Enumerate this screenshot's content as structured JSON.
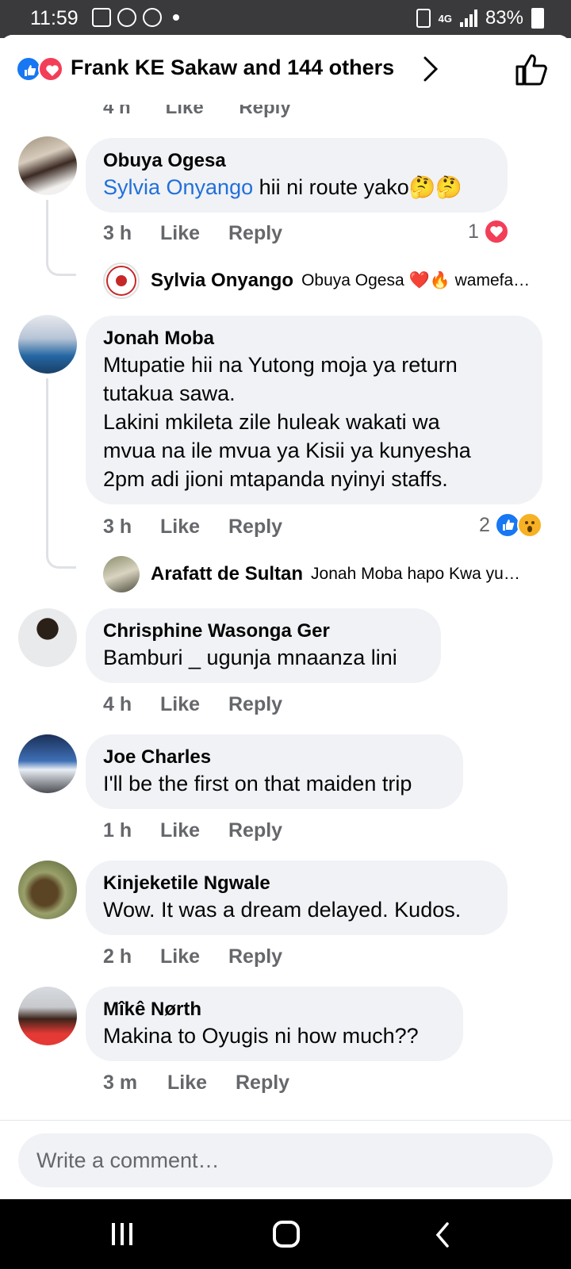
{
  "status_bar": {
    "time": "11:59",
    "network": "4G",
    "battery": "83%"
  },
  "reactions_header": {
    "title": "Frank KE Sakaw and 144 others"
  },
  "partial_comment": {
    "time": "4 h",
    "like": "Like",
    "reply": "Reply"
  },
  "comments": [
    {
      "author": "Obuya Ogesa",
      "mention": "Sylvia Onyango",
      "text": " hii ni route yako🤔🤔",
      "time": "3 h",
      "like": "Like",
      "reply": "Reply",
      "reaction_count": "1",
      "reply_preview": {
        "author": "Sylvia Onyango",
        "text": "Obuya Ogesa ❤️🔥 wamefa…"
      }
    },
    {
      "author": "Jonah Moba",
      "lines": [
        "Mtupatie hii na Yutong moja ya return",
        "tutakua sawa.",
        "Lakini mkileta zile huleak wakati wa",
        "mvua na ile mvua ya Kisii ya kunyesha",
        "2pm adi jioni mtapanda nyinyi staffs."
      ],
      "time": "3 h",
      "like": "Like",
      "reply": "Reply",
      "reaction_count": "2",
      "reply_preview": {
        "author": "Arafatt de Sultan",
        "text": "Jonah Moba hapo Kwa yu…"
      }
    },
    {
      "author": "Chrisphine Wasonga Ger",
      "text": "Bamburi _ ugunja mnaanza lini",
      "time": "4 h",
      "like": "Like",
      "reply": "Reply"
    },
    {
      "author": "Joe Charles",
      "text": "I'll be the first on that maiden trip",
      "time": "1 h",
      "like": "Like",
      "reply": "Reply"
    },
    {
      "author": "Kinjeketile Ngwale",
      "text": "Wow. It was a dream delayed. Kudos.",
      "time": "2 h",
      "like": "Like",
      "reply": "Reply"
    },
    {
      "author": "Mîkê Nørth",
      "text": "Makina to Oyugis ni how much??",
      "time": "3 m",
      "like": "Like",
      "reply": "Reply"
    }
  ],
  "composer": {
    "placeholder": "Write a comment…"
  },
  "colors": {
    "accent": "#1877f2",
    "love": "#f33e58",
    "wow": "#f7b125",
    "mention": "#216fdb",
    "bubble": "#f0f2f5",
    "meta": "#65676b"
  }
}
